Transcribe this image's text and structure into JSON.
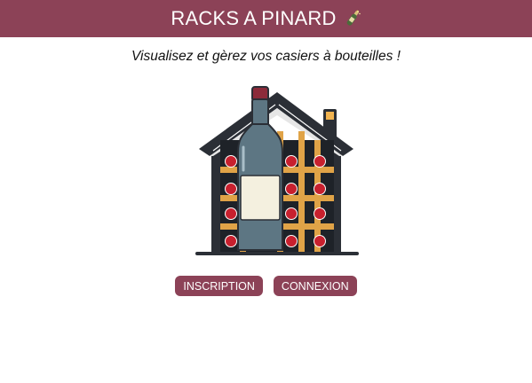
{
  "header": {
    "title": "RACKS A PINARD",
    "icon": "champagne-bottle-icon"
  },
  "main": {
    "subtitle": "Visualisez et gèrez vos casiers à bouteilles !",
    "illustration": "wine-rack-house-with-bottle-illustration"
  },
  "actions": {
    "signup_label": "INSCRIPTION",
    "login_label": "CONNEXION"
  },
  "colors": {
    "brand": "#8c4257",
    "background": "#ffffff",
    "text": "#111111"
  }
}
